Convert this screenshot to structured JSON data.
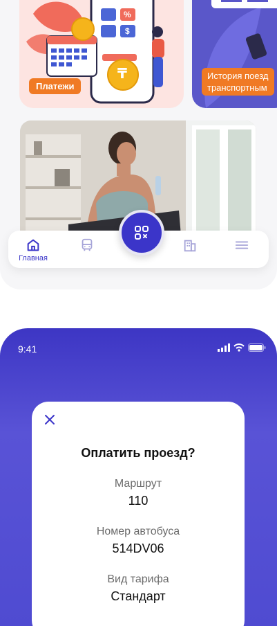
{
  "home": {
    "cards": {
      "payments_label": "Платежи",
      "history_label_line1": "История поезд",
      "history_label_line2": "транспортным"
    },
    "payments_icons": {
      "percent_symbol": "%",
      "dollar_symbol": "$",
      "coin_symbol": "₸"
    },
    "nav": {
      "home_label": "Главная"
    }
  },
  "pay_screen": {
    "status": {
      "time": "9:41"
    },
    "modal": {
      "title": "Оплатить проезд?",
      "route_label": "Маршрут",
      "route_value": "110",
      "bus_label": "Номер автобуса",
      "bus_value": "514DV06",
      "tariff_label": "Вид тарифа",
      "tariff_value": "Стандарт"
    }
  },
  "colors": {
    "accent": "#3b35c9",
    "badge_orange": "#f07a24",
    "screen_bg_top": "#3d36c4",
    "screen_bg_mid": "#5953d6"
  },
  "icons": [
    "home-icon",
    "bus-icon",
    "qr-icon",
    "building-icon",
    "menu-icon",
    "close-icon",
    "signal-icon",
    "wifi-icon",
    "battery-icon"
  ]
}
